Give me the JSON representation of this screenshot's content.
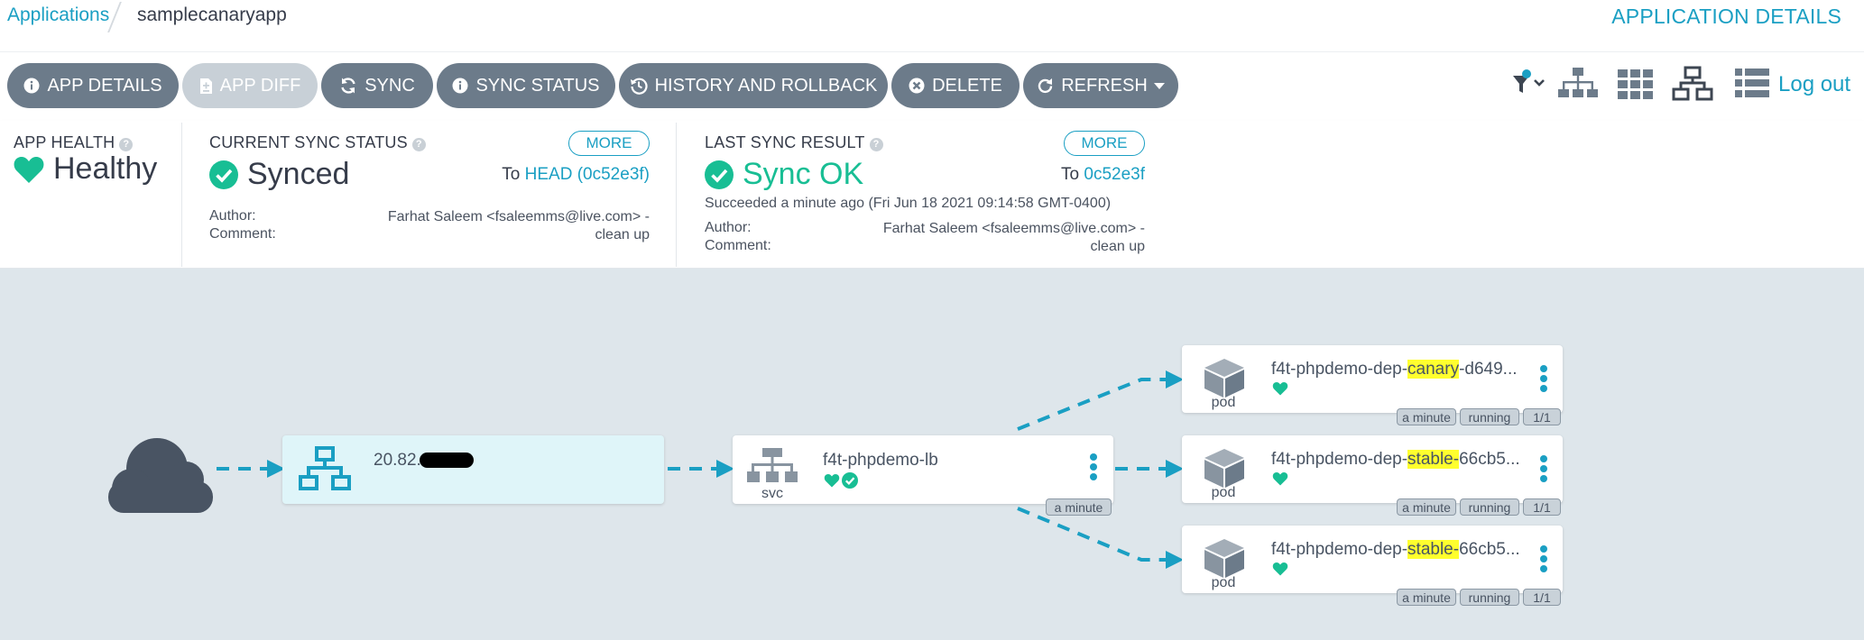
{
  "breadcrumb": {
    "applications": "Applications",
    "app": "samplecanaryapp"
  },
  "page_title": "APPLICATION DETAILS",
  "toolbar": {
    "app_details": "APP DETAILS",
    "app_diff": "APP DIFF",
    "sync": "SYNC",
    "sync_status": "SYNC STATUS",
    "history": "HISTORY AND ROLLBACK",
    "delete": "DELETE",
    "refresh": "REFRESH",
    "logout": "Log out"
  },
  "app_health": {
    "label": "APP HEALTH",
    "value": "Healthy"
  },
  "current_sync": {
    "label": "CURRENT SYNC STATUS",
    "value": "Synced",
    "more": "MORE",
    "to": "To",
    "revision": "HEAD (0c52e3f)",
    "author_label": "Author:",
    "comment_label": "Comment:",
    "author_line1": "Farhat Saleem <fsaleemms@live.com> -",
    "author_line2": "clean up"
  },
  "last_sync": {
    "label": "LAST SYNC RESULT",
    "value": "Sync OK",
    "more": "MORE",
    "to": "To",
    "revision": "0c52e3f",
    "succeeded": "Succeeded a minute ago (Fri Jun 18 2021 09:14:58 GMT-0400)",
    "author_label": "Author:",
    "comment_label": "Comment:",
    "author_line1": "Farhat Saleem <fsaleemms@live.com> -",
    "author_line2": "clean up"
  },
  "graph": {
    "ingress": {
      "ip": "20.82."
    },
    "svc": {
      "name": "f4t-phpdemo-lb",
      "kind": "svc",
      "age": "a minute"
    },
    "pods": [
      {
        "prefix": "f4t-phpdemo-dep-",
        "highlight": "canary",
        "suffix": "-d649...",
        "kind": "pod",
        "age": "a minute",
        "status": "running",
        "ready": "1/1"
      },
      {
        "prefix": "f4t-phpdemo-dep-",
        "highlight": "stable-",
        "suffix": "66cb5...",
        "kind": "pod",
        "age": "a minute",
        "status": "running",
        "ready": "1/1"
      },
      {
        "prefix": "f4t-phpdemo-dep-",
        "highlight": "stable-",
        "suffix": "66cb5...",
        "kind": "pod",
        "age": "a minute",
        "status": "running",
        "ready": "1/1"
      }
    ]
  },
  "colors": {
    "accent": "#1a9fc3",
    "healthy": "#18be94",
    "button": "#6c7b8a",
    "graph_bg": "#dee6eb"
  },
  "icons": [
    "info-icon",
    "file-diff-icon",
    "sync-icon",
    "history-icon",
    "close-circle-icon",
    "refresh-icon",
    "filter-icon",
    "tree-view-icon",
    "grid-view-icon",
    "network-view-icon",
    "list-view-icon",
    "heart-icon",
    "check-circle-icon",
    "cloud-icon",
    "network-icon",
    "service-icon",
    "cube-icon",
    "kebab-menu-icon"
  ]
}
